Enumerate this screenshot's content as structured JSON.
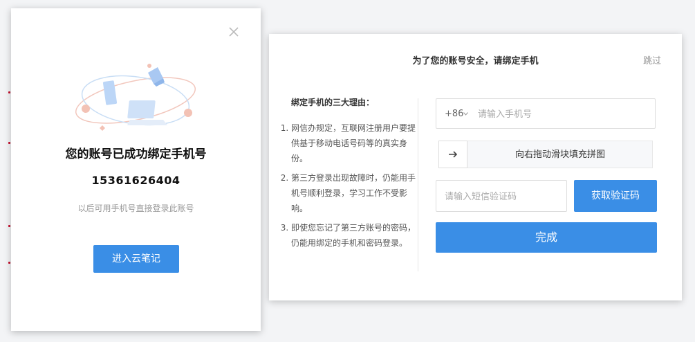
{
  "bound_dialog": {
    "title": "您的账号已成功绑定手机号",
    "phone": "15361626404",
    "hint": "以后可用手机号直接登录此账号",
    "enter_button": "进入云笔记",
    "close_icon": "close-icon",
    "illustration": "devices-orbit-illustration"
  },
  "bind_dialog": {
    "title": "为了您的账号安全，请绑定手机",
    "skip": "跳过",
    "reasons_title": "绑定手机的三大理由：",
    "reasons": [
      "网信办规定，互联网注册用户要提供基于移动电话号码等的真实身份。",
      "第三方登录出现故障时，仍能用手机号顺利登录，学习工作不受影响。",
      "即使您忘记了第三方账号的密码，仍能用绑定的手机和密码登录。"
    ],
    "country_code": "+86",
    "phone_placeholder": "请输入手机号",
    "slider_label": "向右拖动滑块填充拼图",
    "code_placeholder": "请输入短信验证码",
    "get_code_button": "获取验证码",
    "done_button": "完成"
  },
  "colors": {
    "accent": "#3a8ee6",
    "muted_text": "#999999",
    "background": "#f3f4f6"
  }
}
